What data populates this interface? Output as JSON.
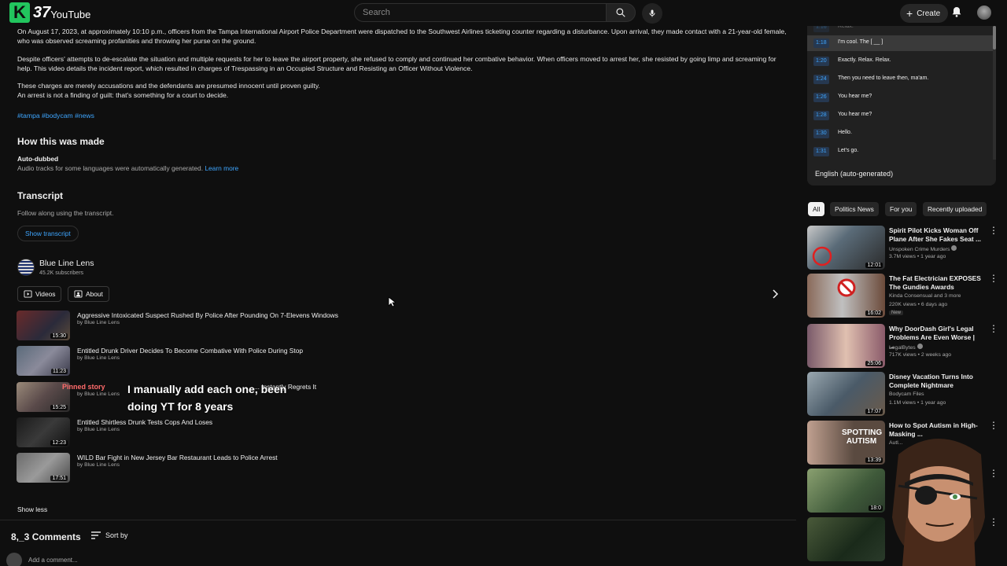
{
  "header": {
    "logo_letter": "K",
    "logo_number": "37",
    "logo_text": "YouTube",
    "search_placeholder": "Search",
    "create_label": "Create"
  },
  "description": {
    "paragraphs": [
      "On August 17, 2023, at approximately 10:10 p.m., officers from the Tampa International Airport Police Department were dispatched to the Southwest Airlines ticketing counter regarding a disturbance. Upon arrival, they made contact with a 21-year-old female, who was observed screaming profanities and throwing her purse on the ground.",
      "Despite officers' attempts to de-escalate the situation and multiple requests for her to leave the airport property, she refused to comply and continued her combative behavior. When officers moved to arrest her, she resisted by going limp and screaming for help. This video details the incident report, which resulted in charges of Trespassing in an Occupied Structure and Resisting an Officer Without Violence.",
      "These charges are merely accusations and the defendants are presumed innocent until proven guilty.",
      "An arrest is not a finding of guilt: that's something for a court to decide."
    ],
    "hashtags": "#tampa #bodycam #news"
  },
  "how_made": {
    "title": "How this was made",
    "subtitle": "Auto-dubbed",
    "text": "Audio tracks for some languages were automatically generated.",
    "link": "Learn more"
  },
  "transcript_section": {
    "title": "Transcript",
    "text": "Follow along using the transcript.",
    "button": "Show transcript"
  },
  "channel": {
    "name": "Blue Line Lens",
    "subscribers": "45.2K subscribers",
    "tabs": [
      "Videos",
      "About"
    ]
  },
  "channel_videos": [
    {
      "title": "Aggressive Intoxicated Suspect Rushed By Police After Pounding On 7-Elevens Windows",
      "by": "by Blue Line Lens",
      "duration": "15:30"
    },
    {
      "title": "Entitled Drunk Driver Decides To Become Combative With Police During Stop",
      "by": "by Blue Line Lens",
      "duration": "11:23"
    },
    {
      "title": "... Instantly Regrets It",
      "by": "by Blue Line Lens",
      "duration": "15:25"
    },
    {
      "title": "Entitled Shirtless Drunk Tests Cops And Loses",
      "by": "by Blue Line Lens",
      "duration": "12:23"
    },
    {
      "title": "WILD Bar Fight in New Jersey Bar Restaurant Leads to Police Arrest",
      "by": "by Blue Line Lens",
      "duration": "17:51"
    }
  ],
  "overlay": {
    "line1": "I manually add each one, been",
    "line2": "doing YT for 8 years",
    "red_label": "Pinned story"
  },
  "show_less": "Show less",
  "comments": {
    "header": "8,_3 Comments",
    "sort": "Sort by",
    "add_placeholder": "Add a comment..."
  },
  "transcript_panel": {
    "rows": [
      {
        "time": "1:18",
        "text": "I'm cool. The [ __ ]",
        "active": true
      },
      {
        "time": "1:20",
        "text": "Exactly. Relax. Relax.",
        "active": false
      },
      {
        "time": "1:24",
        "text": "Then you need to leave then, ma'am.",
        "active": false
      },
      {
        "time": "1:26",
        "text": "You hear me?",
        "active": false
      },
      {
        "time": "1:28",
        "text": "You hear me?",
        "active": false
      },
      {
        "time": "1:30",
        "text": "Hello.",
        "active": false
      },
      {
        "time": "1:31",
        "text": "Let's go.",
        "active": false
      }
    ],
    "language": "English (auto-generated)"
  },
  "chips": [
    "All",
    "Politics News",
    "For you",
    "Recently uploaded"
  ],
  "recommended": [
    {
      "title": "Spirit Pilot Kicks Woman Off Plane After She Fakes Seat ...",
      "channel": "Unspoken Crime Murders",
      "meta": "3.7M views • 1 year ago",
      "duration": "12:01",
      "badge": "",
      "thumb_color": "#5a6b78"
    },
    {
      "title": "The Fat Electrician EXPOSES The Gundies Awards",
      "channel": "Kinda Consensual and 3 more",
      "meta": "220K views • 6 days ago",
      "duration": "16:02",
      "badge": "New",
      "thumb_color": "#6b4a3a"
    },
    {
      "title": "Why DoorDash Girl's Legal Problems Are Even Worse | ...",
      "channel": "LegalBytes",
      "meta": "717K views • 2 weeks ago",
      "duration": "25:06",
      "badge": "",
      "thumb_color": "#8a5a6a"
    },
    {
      "title": "Disney Vacation Turns Into Complete Nightmare",
      "channel": "Bodycam Files",
      "meta": "1.1M views • 1 year ago",
      "duration": "17:07",
      "badge": "",
      "thumb_color": "#4a5a68"
    },
    {
      "title": "How to Spot Autism in High-Masking ...",
      "channel": "Autl...",
      "meta": "",
      "duration": "13:39",
      "badge": "",
      "thumb_color": "#5a4a40",
      "thumb_text": "SPOTTING AUTISM"
    },
    {
      "title": "",
      "channel": "",
      "meta": "",
      "duration": "18:0",
      "badge": "",
      "thumb_color": "#3f5a3a"
    },
    {
      "title": "",
      "channel": "",
      "meta": "",
      "duration": "",
      "badge": "",
      "thumb_color": "#2a3a2a"
    }
  ]
}
